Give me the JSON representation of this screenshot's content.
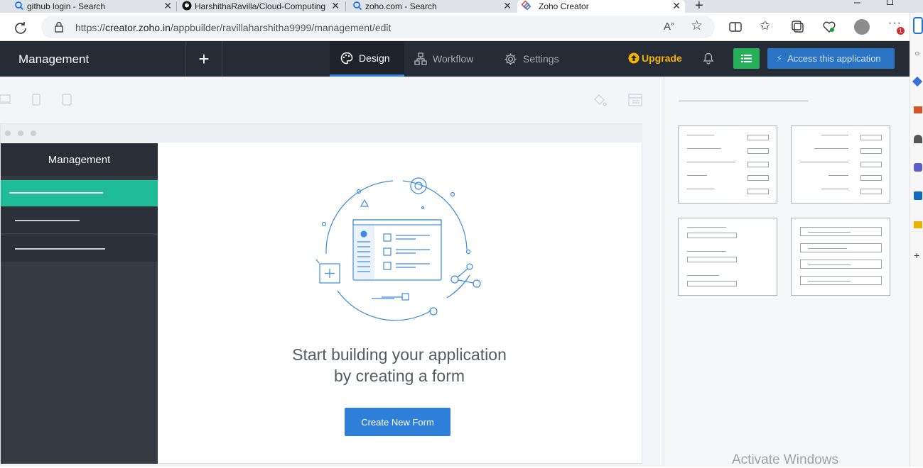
{
  "browser": {
    "tabs": [
      {
        "title": "github login - Search",
        "icon": "search-icon"
      },
      {
        "title": "HarshithaRavilla/Cloud-Computing",
        "icon": "github-icon"
      },
      {
        "title": "zoho.com - Search",
        "icon": "search-icon"
      },
      {
        "title": "Zoho Creator",
        "icon": "zoho-icon",
        "active": true
      }
    ],
    "url_prefix": "https://",
    "url_host": "creator.zoho.in",
    "url_path": "/appbuilder/ravillaharshitha9999/management/edit",
    "notification_badge": "1"
  },
  "header": {
    "app_name": "Management",
    "add_symbol": "+",
    "nav": [
      {
        "label": "Design",
        "icon": "palette-icon",
        "active": true
      },
      {
        "label": "Workflow",
        "icon": "workflow-icon"
      },
      {
        "label": "Settings",
        "icon": "gear-icon"
      }
    ],
    "upgrade_label": "Upgrade",
    "access_label": "Access this application"
  },
  "preview": {
    "sidebar_title": "Management",
    "empty_line1": "Start building your application",
    "empty_line2": "by creating a form",
    "create_button": "Create New Form"
  },
  "system": {
    "watermark": "Activate Windows"
  },
  "colors": {
    "topbar": "#262c36",
    "accent_blue": "#2e7fd9",
    "selected_teal": "#1fbc98",
    "upgrade_gold": "#f5b300",
    "green": "#26b05a"
  }
}
